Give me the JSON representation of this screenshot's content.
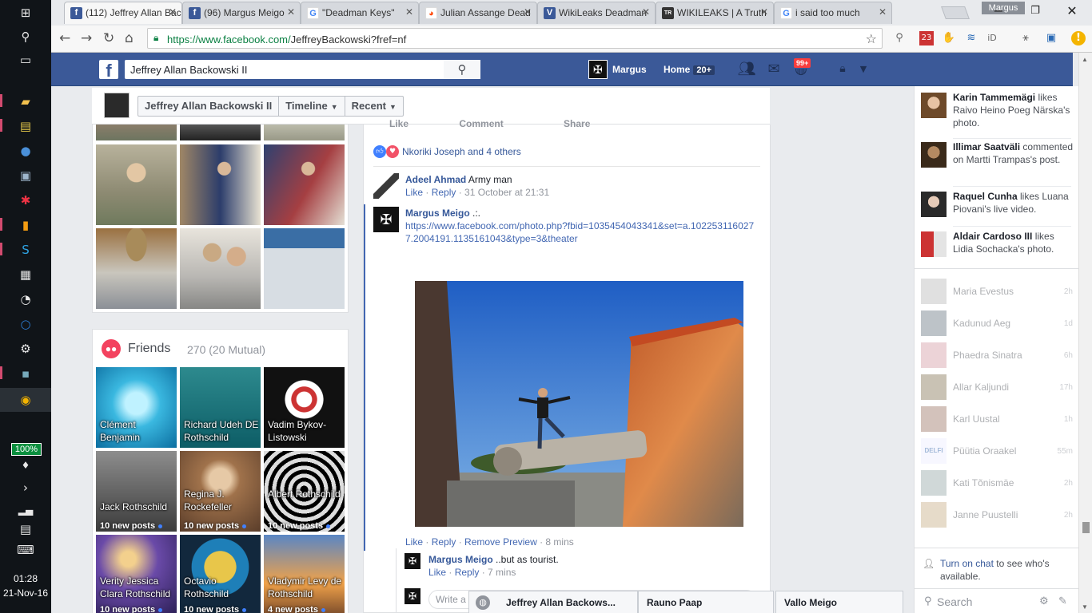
{
  "taskbar": {
    "battery": "100%",
    "time": "01:28",
    "date": "21-Nov-16"
  },
  "browser": {
    "tabs": [
      {
        "title": "(112) Jeffrey Allan Backowski II",
        "favicon": "facebook-icon",
        "color": "#3b5998"
      },
      {
        "title": "(96) Margus Meigo",
        "favicon": "facebook-icon",
        "color": "#3b5998"
      },
      {
        "title": "\"Deadman Keys\"",
        "favicon": "google-icon",
        "color": "#ffffff"
      },
      {
        "title": "Julian Assange Dead",
        "favicon": "reddit-icon",
        "color": "#ffffff"
      },
      {
        "title": "WikiLeaks Deadman",
        "favicon": "v-icon",
        "color": "#3b5998"
      },
      {
        "title": "WIKILEAKS | A Truth",
        "favicon": "truth-icon",
        "color": "#333333"
      },
      {
        "title": "i said too much",
        "favicon": "google-icon",
        "color": "#ffffff"
      }
    ],
    "profile": "Margus",
    "url_host": "https://www.facebook.com/",
    "url_path": "JeffreyBackowski?fref=nf",
    "ext_badge": "23"
  },
  "fb": {
    "search_value": "Jeffrey Allan Backowski II",
    "user_name": "Margus",
    "home_label": "Home",
    "home_count": "20+",
    "notif_count": "99+"
  },
  "timeline_nav": {
    "name": "Jeffrey Allan Backowski II",
    "timeline": "Timeline",
    "recent": "Recent"
  },
  "friends": {
    "title": "Friends",
    "count": "270 (20 Mutual)",
    "items": [
      {
        "name": "Clément Benjamin",
        "posts": ""
      },
      {
        "name": "Richard Udeh DE Rothschild",
        "posts": ""
      },
      {
        "name": "Vadim Bykov-Listowski",
        "posts": ""
      },
      {
        "name": "Jack Rothschild",
        "posts": "10 new posts"
      },
      {
        "name": "Regina J. Rockefeller",
        "posts": "10 new posts"
      },
      {
        "name": "Albert Rothschild",
        "posts": "10 new posts"
      },
      {
        "name": "Verity Jessica Clara Rothschild",
        "posts": "10 new posts"
      },
      {
        "name": "Octavio Rothschild",
        "posts": "10 new posts"
      },
      {
        "name": "Vladymir Levy de Rothschild",
        "posts": "4 new posts"
      }
    ]
  },
  "post": {
    "cut_actions": [
      "Like",
      "Comment",
      "Share"
    ],
    "reactions_text": "Nkoriki Joseph and 4 others",
    "comment1": {
      "author": "Adeel Ahmad",
      "text": "Army man",
      "like": "Like",
      "reply": "Reply",
      "time": "31 October at 21:31"
    },
    "comment2": {
      "author": "Margus Meigo",
      "text": ".:.",
      "link": "https://www.facebook.com/photo.php?fbid=1035454043341&set=a.1022531160277.2004191.1135161043&type=3&theater",
      "like": "Like",
      "reply": "Reply",
      "remove": "Remove Preview",
      "time": "8 mins"
    },
    "reply1": {
      "author": "Margus Meigo",
      "text": "..but as tourist.",
      "like": "Like",
      "reply": "Reply",
      "time": "7 mins"
    },
    "reply_placeholder": "Write a reply..."
  },
  "dock": [
    "Jeffrey Allan Backows...",
    "Rauno Paap",
    "Vallo Meigo"
  ],
  "ticker": [
    {
      "name": "Karin Tammemägi",
      "action": "likes Raivo Heino Poeg Närska's photo."
    },
    {
      "name": "Illimar Saatväli",
      "action": "commented on Martti Trampas's post."
    },
    {
      "name": "Raquel Cunha",
      "action": "likes Luana Piovani's live video."
    },
    {
      "name": "Aldair Cardoso III",
      "action": "likes Lidia Sochacka's photo."
    }
  ],
  "chat": [
    {
      "name": "Maria Evestus",
      "time": "2h"
    },
    {
      "name": "Kadunud Aeg",
      "time": "1d"
    },
    {
      "name": "Phaedra Sinatra",
      "time": "6h"
    },
    {
      "name": "Allar Kaljundi",
      "time": "17h"
    },
    {
      "name": "Karl Uustal",
      "time": "1h"
    },
    {
      "name": "Püütia Oraakel",
      "time": "55m"
    },
    {
      "name": "Kati Tõnismäe",
      "time": "2h"
    },
    {
      "name": "Janne Puustelli",
      "time": "2h"
    }
  ],
  "chat_footer": {
    "turn_on": "Turn on chat",
    "rest": "to see who's available.",
    "search_placeholder": "Search"
  }
}
